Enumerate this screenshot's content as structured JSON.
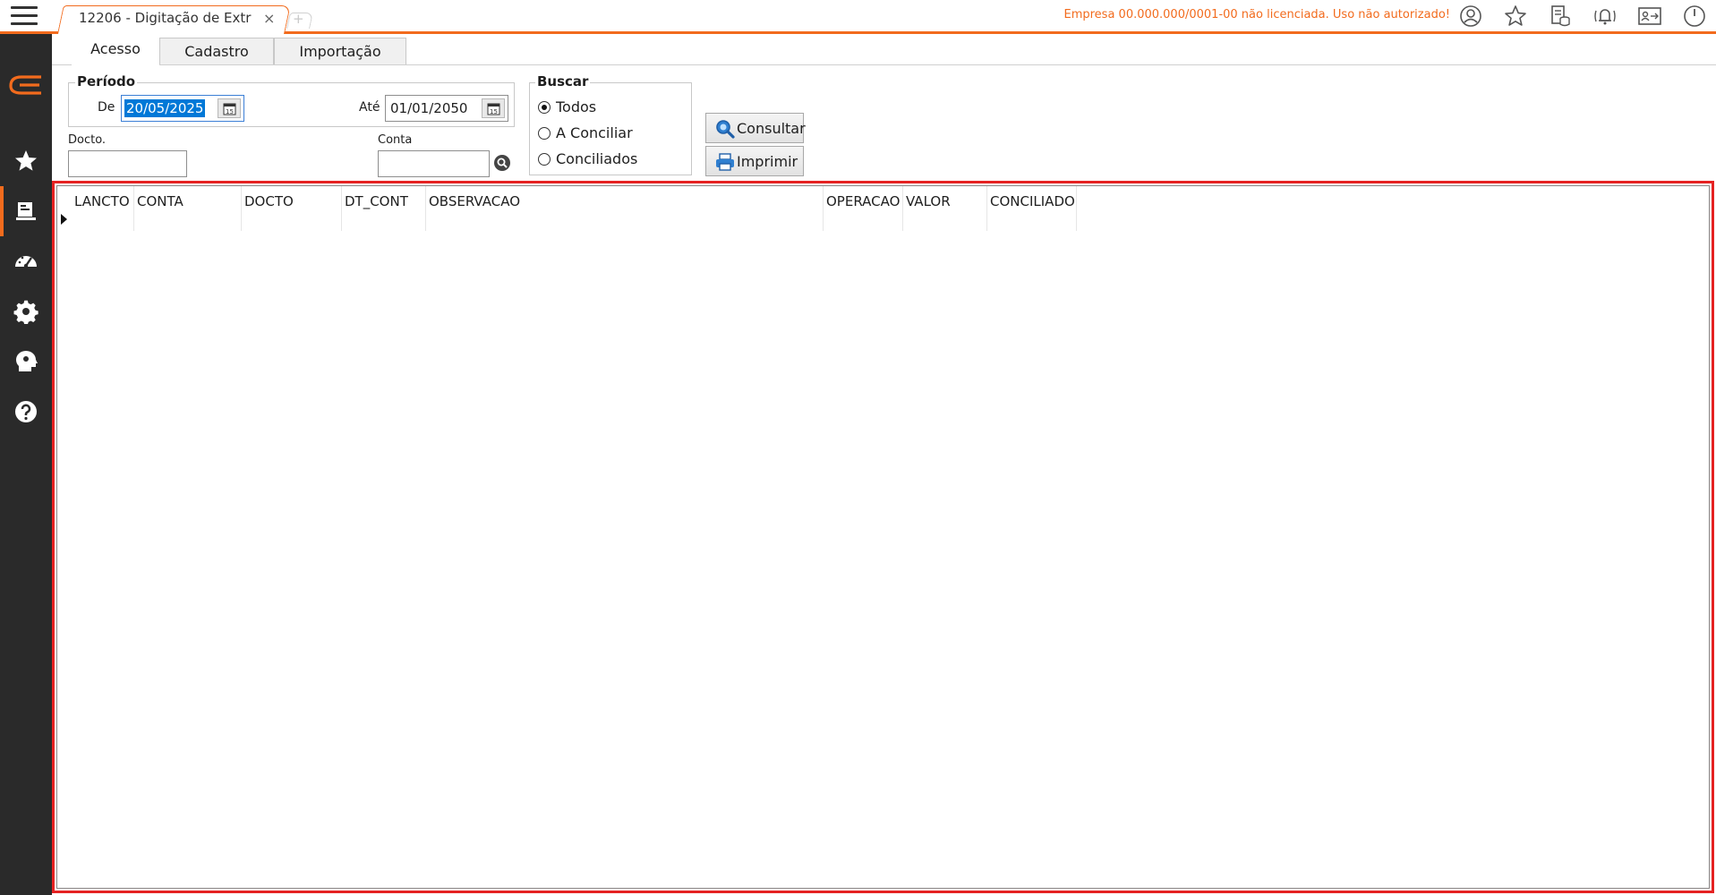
{
  "window": {
    "tab_title": "12206 - Digitação de Extr",
    "tab_close": "×",
    "new_tab": "+",
    "license_message": "Empresa 00.000.000/0001-00 não licenciada. Uso não autorizado!"
  },
  "top_icons": [
    "user-circle-icon",
    "star-icon",
    "database-report-icon",
    "notification-bell-icon",
    "id-card-icon",
    "power-icon"
  ],
  "sidebar": {
    "items": [
      "logo-icon",
      "favorites-star-icon",
      "register-icon",
      "dashboard-gauge-icon",
      "settings-gear-icon",
      "support-head-icon",
      "help-question-icon"
    ],
    "active": "register-icon"
  },
  "tabs": [
    {
      "label": "Acesso",
      "active": true
    },
    {
      "label": "Cadastro",
      "active": false
    },
    {
      "label": "Importação",
      "active": false
    }
  ],
  "periodo": {
    "title": "Período",
    "de_label": "De",
    "de_value": "20/05/2025",
    "ate_label": "Até",
    "ate_value": "01/01/2050"
  },
  "docto": {
    "label": "Docto.",
    "value": ""
  },
  "conta": {
    "label": "Conta",
    "value": ""
  },
  "buscar": {
    "title": "Buscar",
    "options": [
      {
        "label": "Todos",
        "checked": true
      },
      {
        "label": "A Conciliar",
        "checked": false
      },
      {
        "label": "Conciliados",
        "checked": false
      }
    ]
  },
  "buttons": {
    "consultar": "Consultar",
    "imprimir": "Imprimir"
  },
  "grid": {
    "columns": [
      "LANCTO",
      "CONTA",
      "DOCTO",
      "DT_CONT",
      "OBSERVACAO",
      "OPERACAO",
      "VALOR",
      "CONCILIADO"
    ],
    "rows": []
  },
  "colors": {
    "accent": "#f26b1d",
    "sidebar_bg": "#2a2a2a",
    "highlight_border": "#e52222",
    "selection": "#0078d7"
  }
}
